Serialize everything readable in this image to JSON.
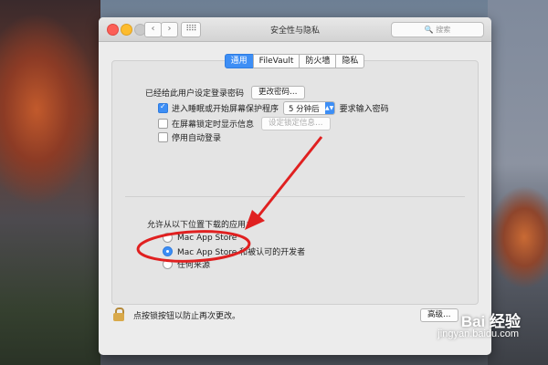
{
  "window": {
    "title": "安全性与隐私",
    "search_placeholder": "搜索",
    "nav_back": "‹",
    "nav_forward": "›",
    "grid_icon": "⠿⠿"
  },
  "tabs": [
    {
      "label": "通用",
      "active": true
    },
    {
      "label": "FileVault",
      "active": false
    },
    {
      "label": "防火墙",
      "active": false
    },
    {
      "label": "隐私",
      "active": false
    }
  ],
  "general": {
    "password_set_text": "已经给此用户设定登录密码",
    "change_password_button": "更改密码…",
    "require_password": {
      "checked": true,
      "prefix": "进入睡眠或开始屏幕保护程序",
      "delay_value": "5 分钟后",
      "suffix": "要求输入密码"
    },
    "show_message": {
      "checked": false,
      "label": "在屏幕锁定时显示信息",
      "button": "设定锁定信息…"
    },
    "disable_auto_login": {
      "checked": false,
      "label": "停用自动登录"
    }
  },
  "downloads": {
    "heading": "允许从以下位置下载的应用：",
    "options": [
      {
        "label": "Mac App Store",
        "selected": false
      },
      {
        "label": "Mac App Store 和被认可的开发者",
        "selected": true
      },
      {
        "label": "任何来源",
        "selected": false
      }
    ]
  },
  "footer": {
    "lock_text": "点按锁按钮以防止再次更改。",
    "advanced_button": "高级…"
  },
  "watermark": {
    "brand": "Bai 经验",
    "url": "jingyan.baidu.com"
  },
  "colors": {
    "accent": "#3d8ef5",
    "annotation": "#e02020"
  }
}
